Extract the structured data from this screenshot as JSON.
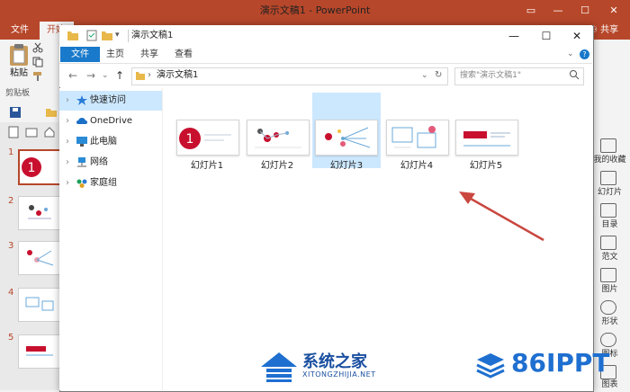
{
  "ppt": {
    "title": "演示文稿1 - PowerPoint",
    "file_tab": "文件",
    "home_tab": "开始",
    "share": "共享",
    "paste": "粘贴",
    "clipboard_group": "剪贴板",
    "slide_numbers": [
      "1",
      "2",
      "3",
      "4",
      "5"
    ],
    "right_pane": [
      "我的收藏",
      "幻灯片",
      "目录",
      "范文",
      "图片",
      "形状",
      "图标",
      "图表"
    ]
  },
  "explorer": {
    "title": "演示文稿1",
    "tabs": {
      "file": "文件",
      "home": "主页",
      "share": "共享",
      "view": "查看"
    },
    "address_path": "演示文稿1",
    "search_placeholder": "搜索\"演示文稿1\"",
    "nav": {
      "quick_access": "快速访问",
      "onedrive": "OneDrive",
      "this_pc": "此电脑",
      "network": "网络",
      "homegroup": "家庭组"
    },
    "items": [
      "幻灯片1",
      "幻灯片2",
      "幻灯片3",
      "幻灯片4",
      "幻灯片5"
    ],
    "selected_index": 2
  },
  "watermarks": {
    "site1_name": "系统之家",
    "site1_url": "XITONGZHIJIA.NET",
    "site2_name": "86IPPT"
  },
  "colors": {
    "ppt_accent": "#b7472a",
    "explorer_accent": "#1979ca",
    "selection": "#cce8ff",
    "slide_red": "#c8102e",
    "arrow": "#c9473f"
  },
  "icons": {
    "explorer_app": "folder-icon",
    "pin": "pin-icon",
    "cloud": "cloud-icon",
    "computer": "monitor-icon",
    "network": "network-icon",
    "homegroup": "homegroup-icon"
  }
}
